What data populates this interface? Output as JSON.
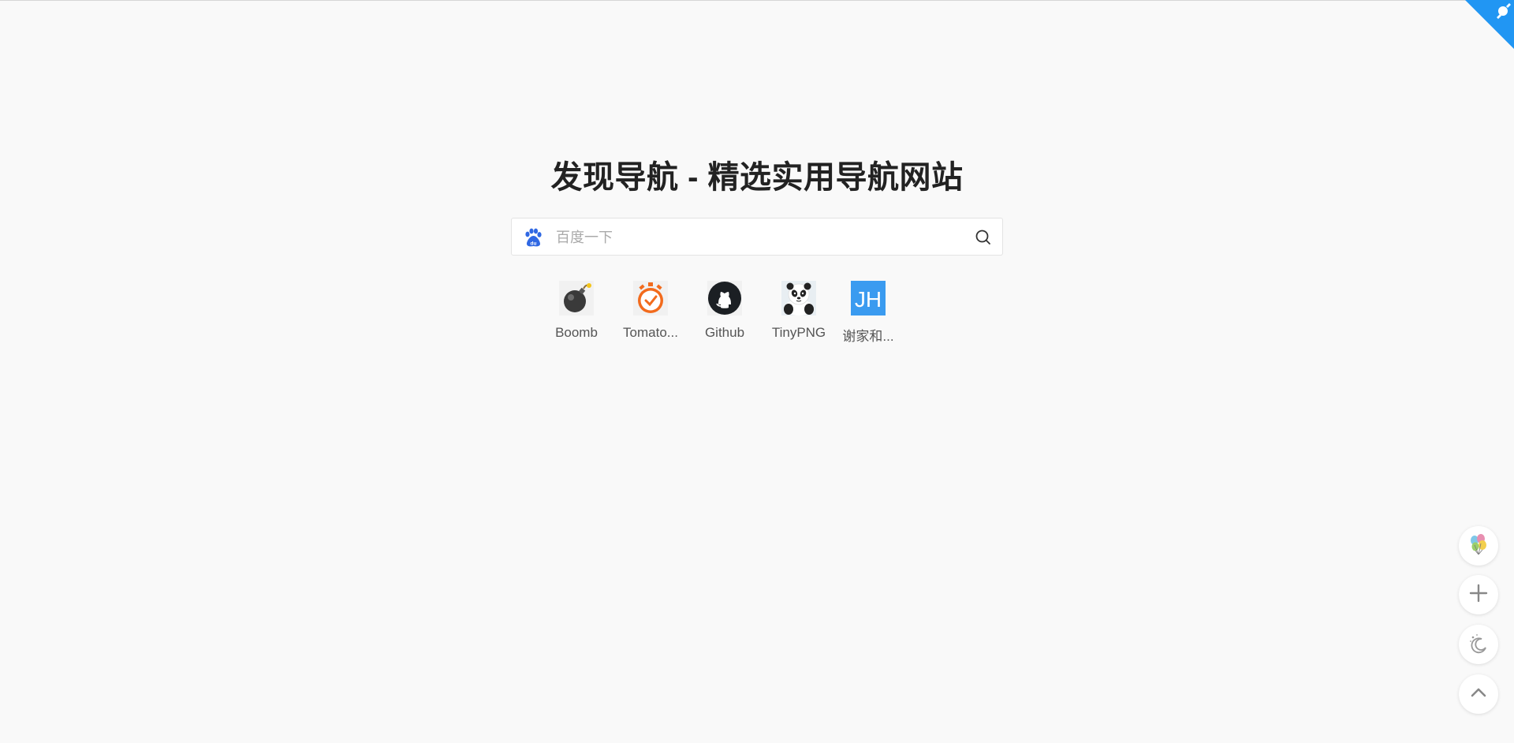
{
  "header": {
    "title": "发现导航 - 精选实用导航网站"
  },
  "search": {
    "engine_icon": "baidu-paw-icon",
    "placeholder": "百度一下",
    "value": "",
    "submit_icon": "search-icon"
  },
  "shortcuts": [
    {
      "label": "Boomb",
      "icon": "bomb-icon"
    },
    {
      "label": "Tomato...",
      "icon": "stopwatch-icon"
    },
    {
      "label": "Github",
      "icon": "github-icon"
    },
    {
      "label": "TinyPNG",
      "icon": "panda-icon"
    },
    {
      "label": "谢家和...",
      "icon": "jh-logo-icon",
      "icon_text": "JH"
    }
  ],
  "float_buttons": [
    {
      "icon": "balloons-icon"
    },
    {
      "icon": "plus-icon"
    },
    {
      "icon": "moon-icon"
    },
    {
      "icon": "chevron-up-icon"
    }
  ],
  "colors": {
    "background": "#f9f9f9",
    "corner_accent": "#2196f3",
    "baidu_blue": "#3068e3",
    "jh_blue": "#3a9bf0"
  }
}
